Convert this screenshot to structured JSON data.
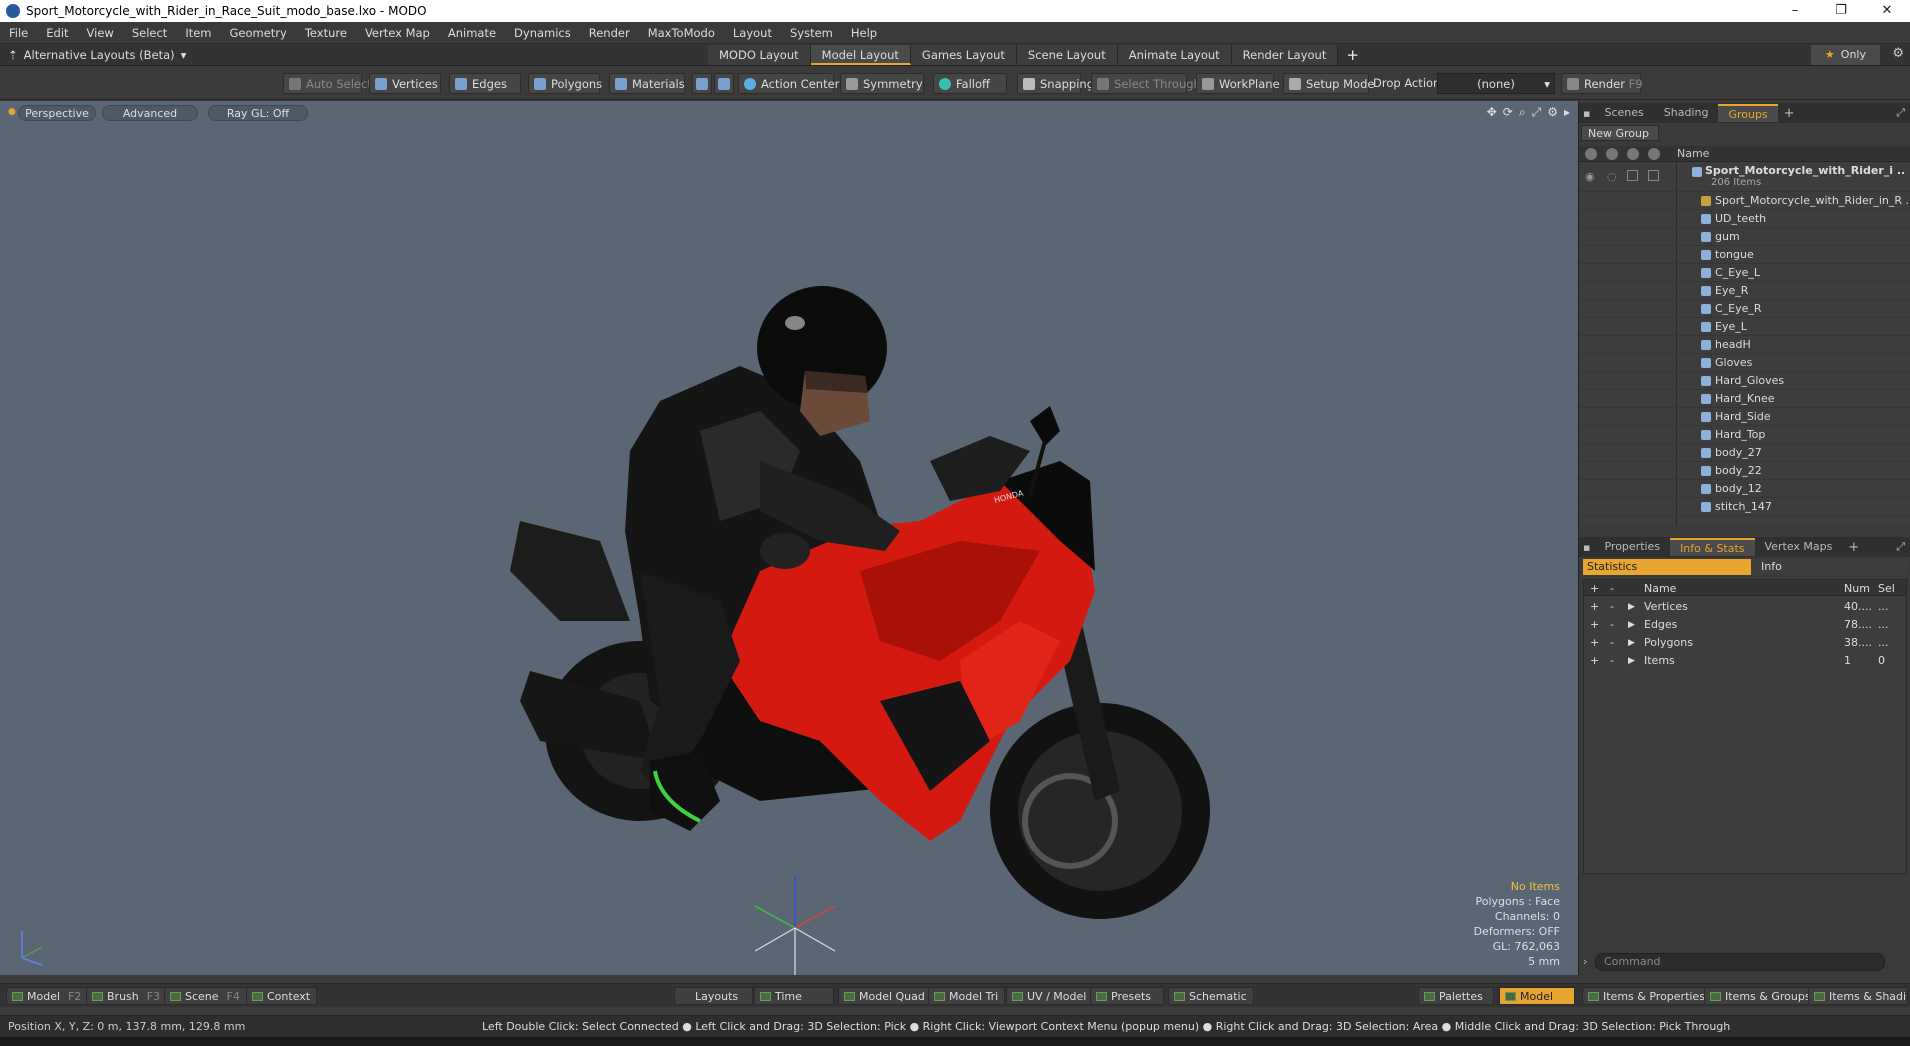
{
  "window": {
    "title": "Sport_Motorcycle_with_Rider_in_Race_Suit_modo_base.lxo - MODO",
    "minimize": "–",
    "maximize": "❐",
    "close": "✕"
  },
  "menu": [
    "File",
    "Edit",
    "View",
    "Select",
    "Item",
    "Geometry",
    "Texture",
    "Vertex Map",
    "Animate",
    "Dynamics",
    "Render",
    "MaxToModo",
    "Layout",
    "System",
    "Help"
  ],
  "layoutbar": {
    "alt_layouts": "Alternative Layouts (Beta)",
    "tabs": [
      "MODO Layout",
      "Model Layout",
      "Games Layout",
      "Scene Layout",
      "Animate Layout",
      "Render Layout"
    ],
    "active_tab": "Model Layout",
    "add": "+",
    "only": "Only"
  },
  "toolbar": {
    "auto_select": "Auto Select",
    "vertices": "Vertices",
    "edges": "Edges",
    "polygons": "Polygons",
    "materials": "Materials",
    "action_center": "Action Center",
    "symmetry": "Symmetry",
    "falloff": "Falloff",
    "snapping": "Snapping",
    "select_through": "Select Through",
    "workplane": "WorkPlane",
    "setup_mode": "Setup Mode",
    "drop_action": "Drop Action",
    "drop_value": "(none)",
    "render": "Render",
    "render_key": "F9"
  },
  "viewport": {
    "perspective": "Perspective",
    "advanced": "Advanced",
    "raygl": "Ray GL: Off",
    "info": {
      "no_items": "No Items",
      "polygons": "Polygons : Face",
      "channels": "Channels: 0",
      "deformers": "Deformers: OFF",
      "gl": "GL: 762,063",
      "scale": "5 mm"
    }
  },
  "groups_panel": {
    "tabs": [
      "Scenes",
      "Shading",
      "Groups"
    ],
    "active_tab": "Groups",
    "new_group": "New Group",
    "name_header": "Name",
    "root": "Sport_Motorcycle_with_Rider_i ...",
    "root_count": "206 Items",
    "items": [
      "Sport_Motorcycle_with_Rider_in_R ...",
      "UD_teeth",
      "gum",
      "tongue",
      "C_Eye_L",
      "Eye_R",
      "C_Eye_R",
      "Eye_L",
      "headH",
      "Gloves",
      "Hard_Gloves",
      "Hard_Knee",
      "Hard_Side",
      "Hard_Top",
      "body_27",
      "body_22",
      "body_12",
      "stitch_147"
    ]
  },
  "stats_panel": {
    "tabs": [
      "Properties",
      "Info & Stats",
      "Vertex Maps"
    ],
    "active_tab": "Info & Stats",
    "sub_tabs": [
      "Statistics",
      "Info"
    ],
    "headers": [
      "Name",
      "Num",
      "Sel"
    ],
    "rows": [
      {
        "name": "Vertices",
        "num": "40....",
        "sel": "..."
      },
      {
        "name": "Edges",
        "num": "78....",
        "sel": "..."
      },
      {
        "name": "Polygons",
        "num": "38....",
        "sel": "..."
      },
      {
        "name": "Items",
        "num": "1",
        "sel": "0"
      }
    ],
    "command_placeholder": "Command"
  },
  "bottombar": {
    "model": "Model",
    "model_key": "F2",
    "brush": "Brush",
    "brush_key": "F3",
    "scene": "Scene",
    "scene_key": "F4",
    "context": "Context",
    "layouts": "Layouts",
    "time": "Time",
    "model_quad": "Model Quad",
    "model_tri": "Model Tri",
    "uv_model": "UV / Model",
    "presets": "Presets",
    "schematic": "Schematic",
    "palettes": "Palettes",
    "model_active": "Model",
    "items_properties": "Items & Properties",
    "items_groups": "Items & Groups",
    "items_shading": "Items & Shading"
  },
  "statusbar": {
    "position": "Position X, Y, Z:   0 m, 137.8 mm, 129.8 mm",
    "hint": "Left Double Click: Select Connected ● Left Click and Drag: 3D Selection: Pick ● Right Click: Viewport Context Menu (popup menu) ● Right Click and Drag: 3D Selection: Area ● Middle Click and Drag: 3D Selection: Pick Through"
  },
  "colors": {
    "accent": "#e8a530",
    "viewport_bg": "#5b6674",
    "bike_red": "#d41a10"
  }
}
